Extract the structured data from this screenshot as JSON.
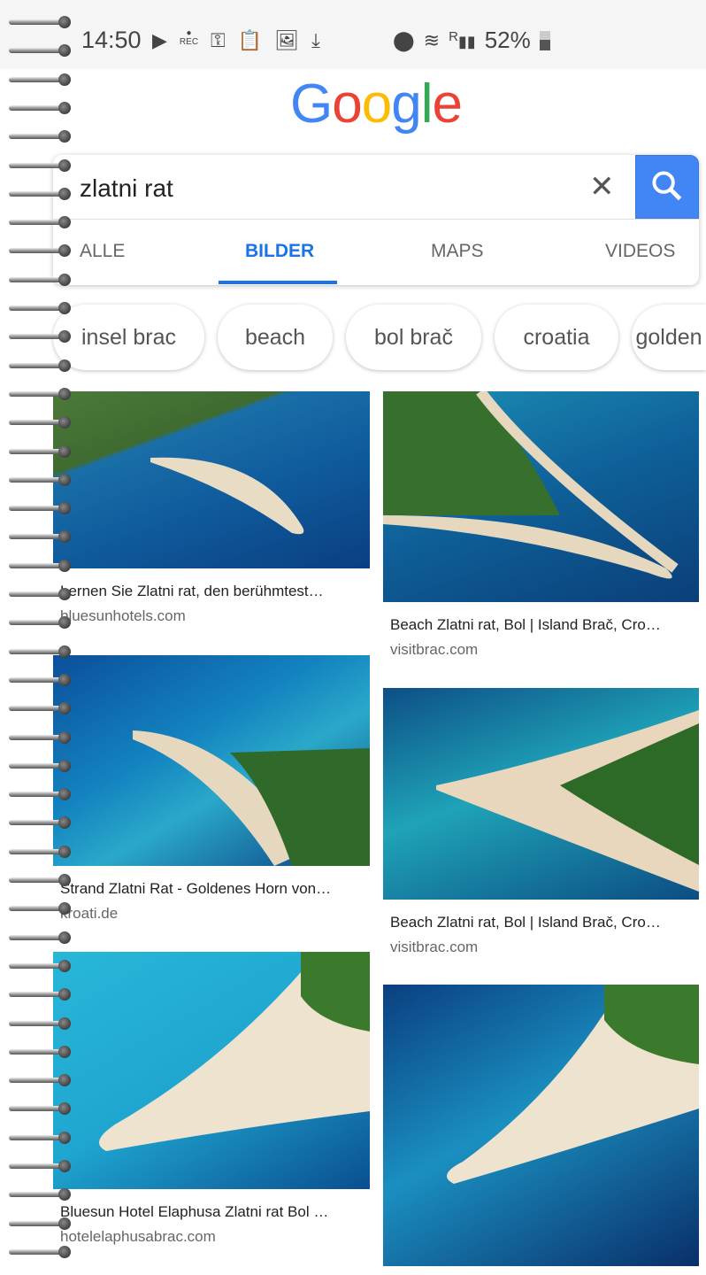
{
  "status": {
    "time": "14:50",
    "battery": "52%",
    "icons": [
      "terminal-icon",
      "rec-icon",
      "key-icon",
      "clipboard-icon",
      "image-icon",
      "download-icon",
      "location-icon",
      "wifi-icon",
      "signal-icon",
      "battery-charging-icon"
    ],
    "rec": "REC",
    "roaming": "R"
  },
  "logo": {
    "letters": [
      "G",
      "o",
      "o",
      "g",
      "l",
      "e"
    ],
    "colors": [
      "#4285f4",
      "#ea4335",
      "#fbbc05",
      "#4285f4",
      "#34a853",
      "#ea4335"
    ]
  },
  "search": {
    "query": "zlatni rat",
    "clear": "✕"
  },
  "tabs": [
    {
      "label": "ALLE"
    },
    {
      "label": "BILDER",
      "active": true
    },
    {
      "label": "MAPS"
    },
    {
      "label": "VIDEOS"
    }
  ],
  "chips": [
    {
      "label": "insel brac"
    },
    {
      "label": "beach"
    },
    {
      "label": "bol brač"
    },
    {
      "label": "croatia"
    },
    {
      "label": "golden"
    }
  ],
  "results": [
    {
      "title": "Lernen Sie Zlatni rat, den berühmtest…",
      "domain": "bluesunhotels.com"
    },
    {
      "title": "Beach Zlatni rat, Bol | Island Brač, Cro…",
      "domain": "visitbrac.com"
    },
    {
      "title": "Strand Zlatni Rat - Goldenes Horn von…",
      "domain": "kroati.de"
    },
    {
      "title": "Beach Zlatni rat, Bol | Island Brač, Cro…",
      "domain": "visitbrac.com"
    },
    {
      "title": "Bluesun Hotel Elaphusa Zlatni rat Bol …",
      "domain": "hotelelaphusabrac.com"
    },
    {
      "title": "",
      "domain": ""
    }
  ],
  "colors": {
    "accent": "#1a73e8",
    "search_button": "#4285f4"
  }
}
